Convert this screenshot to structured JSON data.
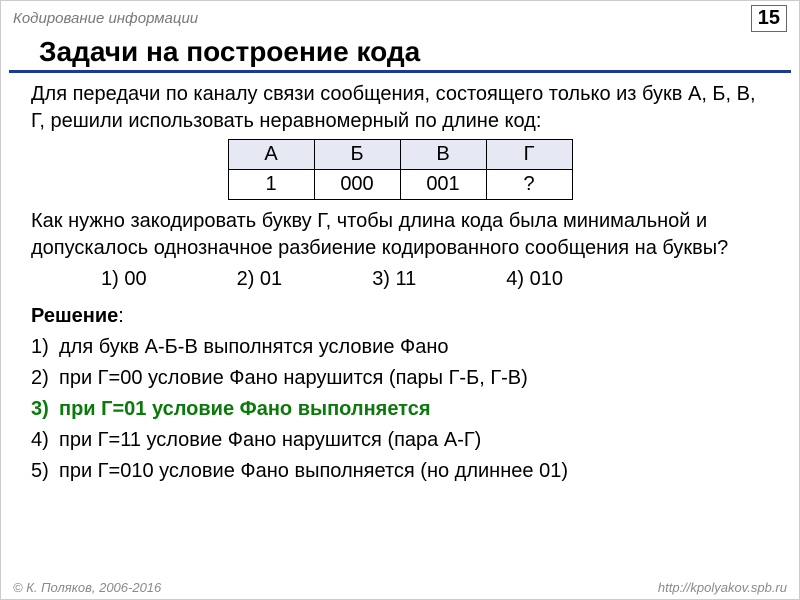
{
  "header": {
    "topic": "Кодирование информации",
    "page": "15"
  },
  "title": "Задачи на построение кода",
  "intro": "Для передачи по каналу связи сообщения, состоящего только из букв А, Б, В, Г, решили использовать неравномерный по длине код:",
  "table": {
    "headers": [
      "А",
      "Б",
      "В",
      "Г"
    ],
    "values": [
      "1",
      "000",
      "001",
      "?"
    ]
  },
  "question": "Как нужно закодировать букву Г, чтобы длина кода была минимальной и допускалось однозначное разбиение кодированного сообщения на буквы?",
  "options": [
    "1) 00",
    "2) 01",
    "3) 11",
    "4) 010"
  ],
  "solution_label": "Решение",
  "solution": [
    {
      "n": "1)",
      "text": "для букв А-Б-В выполнятся условие Фано",
      "hl": false
    },
    {
      "n": "2)",
      "text": "при Г=00 условие Фано нарушится (пары Г-Б,  Г-В)",
      "hl": false
    },
    {
      "n": "3)",
      "text": "при Г=01 условие Фано выполняется",
      "hl": true
    },
    {
      "n": "4)",
      "text": "при Г=11 условие Фано нарушится (пара А-Г)",
      "hl": false
    },
    {
      "n": "5)",
      "text": "при Г=010 условие Фано выполняется (но длиннее 01)",
      "hl": false
    }
  ],
  "footer": {
    "left": "© К. Поляков, 2006-2016",
    "right": "http://kpolyakov.spb.ru"
  }
}
